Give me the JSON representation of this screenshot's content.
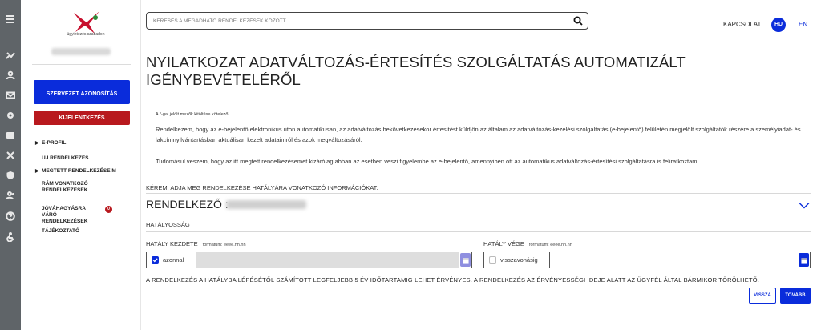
{
  "logo": {
    "tagline": "ügyintézés szabadon"
  },
  "sidebar": {
    "org_button": "SZERVEZET AZONOSÍTÁS",
    "logout_button": "KIJELENTKEZÉS",
    "items": [
      {
        "label": "E-PROFIL",
        "caret": "▶"
      },
      {
        "label": "ÚJ RENDELKEZÉS",
        "caret": ""
      },
      {
        "label": "MEGTETT RENDELKEZÉSEIM",
        "caret": "▶"
      },
      {
        "label": "RÁM VONATKOZÓ RENDELKEZÉSEK",
        "caret": ""
      },
      {
        "label": "JÓVÁHAGYÁSRA VÁRÓ RENDELKEZÉSEK",
        "caret": "",
        "badge": "0"
      },
      {
        "label": "TÁJÉKOZTATÓ",
        "caret": ""
      }
    ]
  },
  "header": {
    "search_placeholder": "KERESÉS A MEGADHATÓ RENDELKEZÉSEK KÖZÖTT",
    "contact": "KAPCSOLAT",
    "lang_active": "HU",
    "lang_other": "EN"
  },
  "main": {
    "title": "NYILATKOZAT ADATVÁLTOZÁS-ÉRTESÍTÉS SZOLGÁLTATÁS AUTOMATIZÁLT IGÉNYBEVÉTELÉRŐL",
    "required_note": "A *-gal jelölt mezők kitöltése kötelező!",
    "paragraph1": "Rendelkezem, hogy az e-bejelentő elektronikus úton automatikusan, az adatváltozás bekövetkezésekor értesítést küldjön az általam az adatváltozás-kezelési szolgáltatás (e-bejelentő) felületén megjelölt szolgáltatók részére a személyiadat- és lakcímnyilvántartásban aktuálisan kezelt adataimról és azok megváltozásáról.",
    "paragraph2": "Tudomásul veszem, hogy az itt megtett rendelkezésemet kizárólag abban az esetben veszi figyelembe az e-bejelentő, amennyiben ott az automatikus adatváltozás-értesítési szolgáltatásra is feliratkoztam.",
    "ask": "KÉREM, ADJA MEG RENDELKEZÉSE HATÁLYÁRA VONATKOZÓ INFORMÁCIÓKAT:",
    "rendelkezo_label": "RENDELKEZŐ :",
    "hatalyossag": "HATÁLYOSSÁG",
    "start_label": "HATÁLY KEZDETE",
    "start_format": "formátum: éééé.hh.nn",
    "start_checkbox": "azonnal",
    "start_checked": true,
    "end_label": "HATÁLY VÉGE",
    "end_format": "formátum: éééé.hh.nn",
    "end_checkbox": "visszavonásig",
    "end_checked": false,
    "validity_note": "A RENDELKEZÉS A HATÁLYBA LÉPÉSÉTŐL SZÁMÍTOTT LEGFELJEBB 5 ÉV IDŐTARTAMIG LEHET ÉRVÉNYES. A RENDELKEZÉS AZ ÉRVÉNYESSÉGI IDEJE ALATT AZ ÜGYFÉL ÁLTAL BÁRMIKOR TÖRÖLHETŐ.",
    "back_button": "VISSZA",
    "next_button": "TOVÁBB"
  },
  "colors": {
    "accent": "#0a2cdb",
    "danger": "#b8191e",
    "rail": "#5f6468"
  }
}
